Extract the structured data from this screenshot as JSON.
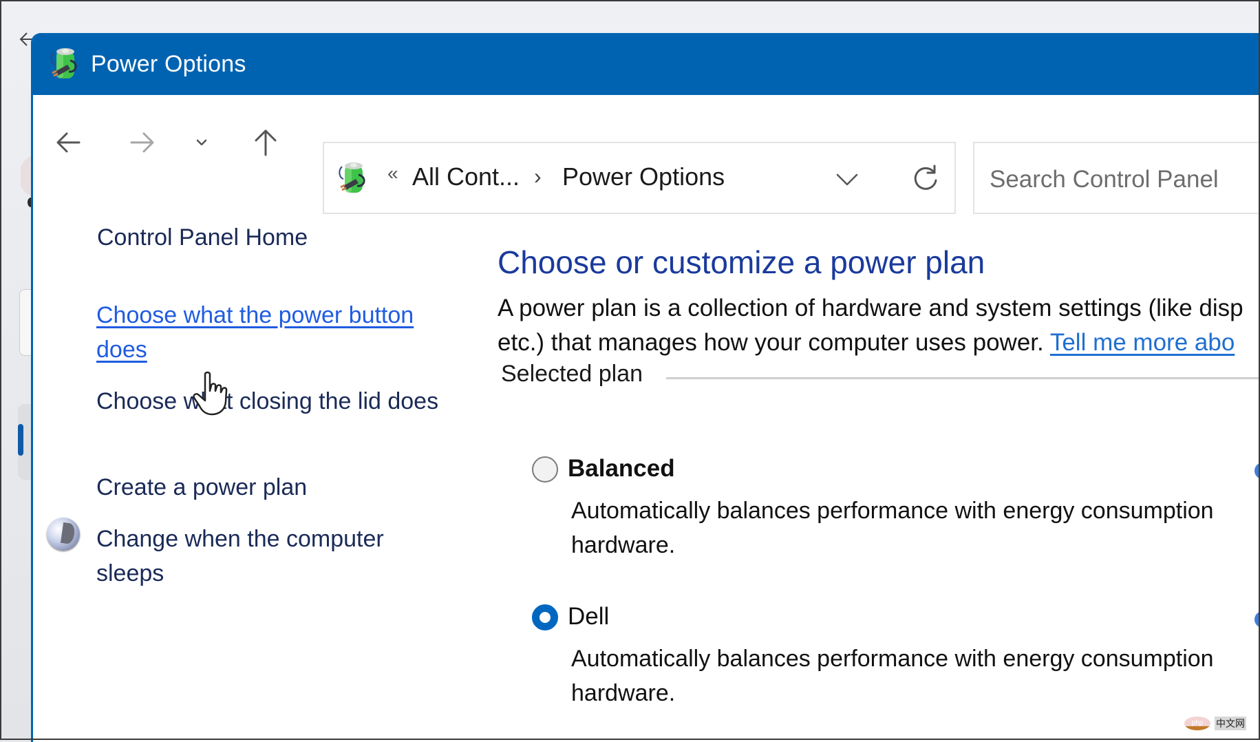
{
  "window": {
    "title": "Power Options",
    "title_icon": "power-options-battery-icon",
    "accent_color": "#0063b1"
  },
  "toolbar": {
    "back_icon": "arrow-left-icon",
    "forward_icon": "arrow-right-icon",
    "recent_icon": "chevron-down-icon",
    "up_icon": "arrow-up-icon",
    "address": {
      "overflow_glyph": "«",
      "breadcrumbs": [
        "All Cont...",
        "Power Options"
      ],
      "separator": "›",
      "dropdown_icon": "chevron-down-icon",
      "refresh_icon": "refresh-icon"
    },
    "search": {
      "placeholder": "Search Control Panel",
      "value": ""
    }
  },
  "left_nav": {
    "home": "Control Panel Home",
    "links": [
      {
        "label": "Choose what the power button does",
        "state": "hover"
      },
      {
        "label": "Choose what closing the lid does"
      },
      {
        "label": "Create a power plan"
      },
      {
        "label": "Change when the computer sleeps",
        "icon": "sleep-moon-icon"
      }
    ]
  },
  "main": {
    "title": "Choose or customize a power plan",
    "intro_line1": "A power plan is a collection of hardware and system settings (like disp",
    "intro_line2": "etc.) that manages how your computer uses power.",
    "intro_link": "Tell me more abo",
    "section_label": "Selected plan",
    "plans": [
      {
        "name": "Balanced",
        "selected": false,
        "desc_line1": "Automatically balances performance with energy consumption",
        "desc_line2": "hardware."
      },
      {
        "name": "Dell",
        "selected": true,
        "desc_line1": "Automatically balances performance with energy consumption",
        "desc_line2": "hardware."
      }
    ]
  },
  "watermark": {
    "logo": "php",
    "text": "中文网"
  }
}
